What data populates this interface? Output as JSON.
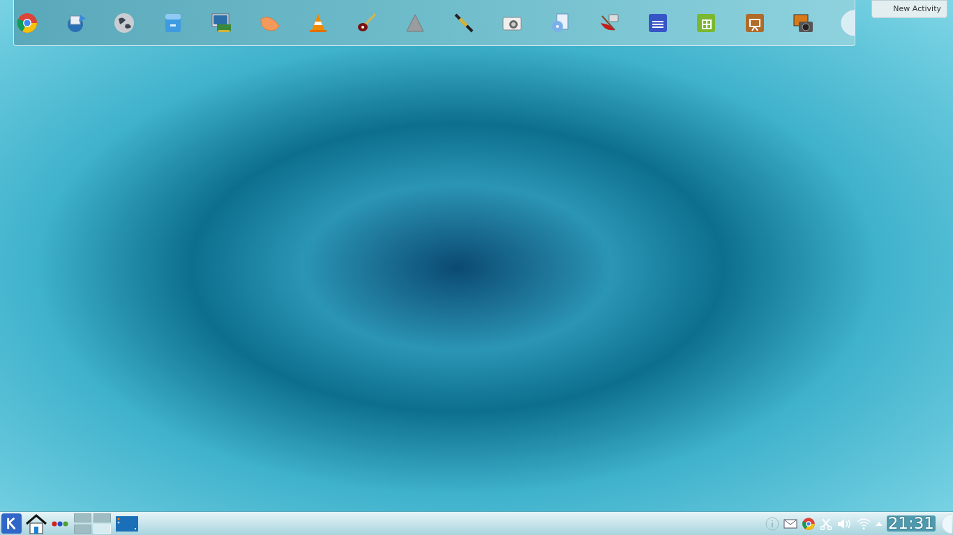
{
  "activity_button": {
    "label": "New Activity"
  },
  "pager": [
    {
      "selected": false
    },
    {
      "selected": false
    },
    {
      "selected": false
    },
    {
      "selected": true
    }
  ],
  "clock": {
    "time": "21:31"
  }
}
